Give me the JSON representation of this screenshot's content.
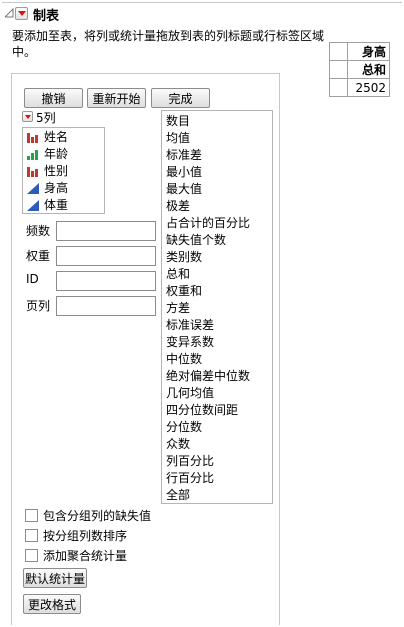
{
  "header": {
    "title": "制表"
  },
  "hint": "要添加至表，将列或统计量拖放到表的列标题或行标签区域中。",
  "buttons": {
    "cancel": "撤销",
    "restart": "重新开始",
    "done": "完成"
  },
  "columns": {
    "header": "5列",
    "items": [
      {
        "label": "姓名",
        "icon": "nominal-bar-icon",
        "color": "#c0392b"
      },
      {
        "label": "年龄",
        "icon": "ordinal-bar-icon",
        "color": "#27a34a"
      },
      {
        "label": "性别",
        "icon": "nominal-bar-icon",
        "color": "#c0392b"
      },
      {
        "label": "身高",
        "icon": "continuous-triangle-icon",
        "color": "#2b5db8"
      },
      {
        "label": "体重",
        "icon": "continuous-triangle-icon",
        "color": "#2b5db8"
      }
    ]
  },
  "roles": {
    "freq": "频数",
    "weight": "权重",
    "id": "ID",
    "page": "页列"
  },
  "statistics": [
    "数目",
    "均值",
    "标准差",
    "最小值",
    "最大值",
    "极差",
    "占合计的百分比",
    "缺失值个数",
    "类别数",
    "总和",
    "权重和",
    "方差",
    "标准误差",
    "变异系数",
    "中位数",
    "绝对偏差中位数",
    "几何均值",
    "四分位数间距",
    "分位数",
    "众数",
    "列百分比",
    "行百分比",
    "全部"
  ],
  "options": {
    "include_missing": "包含分组列的缺失值",
    "sort_by_freq": "按分组列数排序",
    "add_aggregate": "添加聚合统计量"
  },
  "bottom_buttons": {
    "default_stats": "默认统计量",
    "change_format": "更改格式"
  },
  "table": {
    "col_header": "身高",
    "row_header": "总和",
    "value": "2502"
  }
}
